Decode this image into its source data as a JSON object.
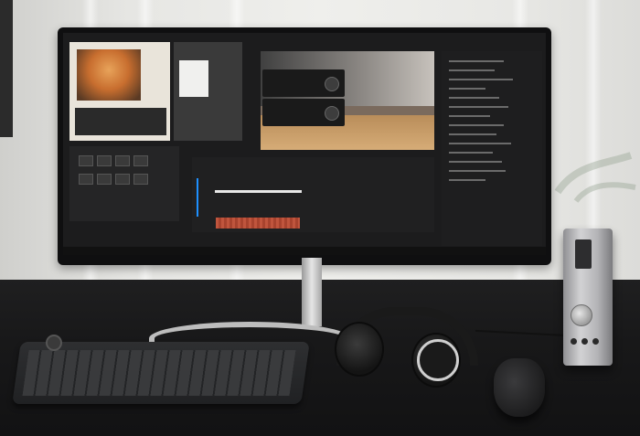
{
  "scene": {
    "description": "",
    "screen": {
      "app_name": "",
      "panels": {
        "source_monitor": {},
        "program_monitor": {},
        "project_panel": {},
        "timeline": {}
      }
    }
  },
  "colors": {
    "desk": "#181819",
    "monitor_bezel": "#0f0f10",
    "timeline_track_red": "#c0553d",
    "playhead_blue": "#1e90ff",
    "dac_silver": "#c9c9cc"
  },
  "icons": {
    "knob": "knob-icon",
    "headphones": "headphones-icon",
    "mouse": "mouse-icon",
    "keyboard": "keyboard-icon"
  }
}
